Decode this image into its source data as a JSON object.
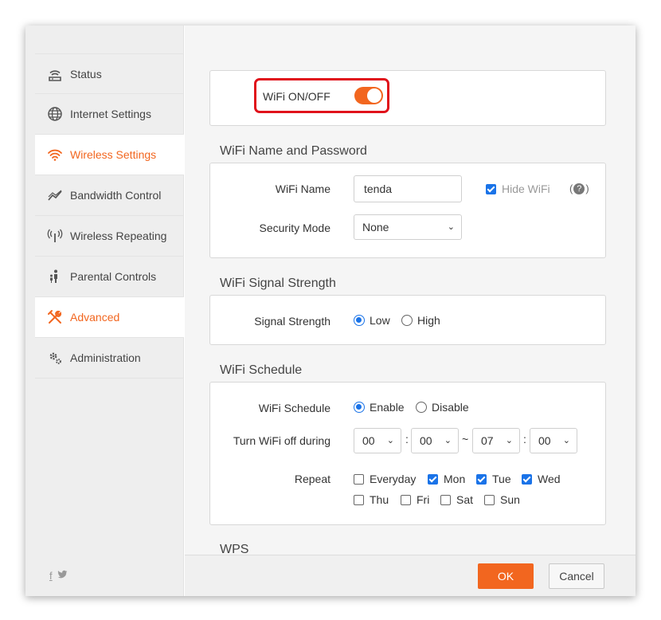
{
  "sidebar": {
    "items": [
      {
        "label": "Status",
        "icon": "router-icon",
        "active": false
      },
      {
        "label": "Internet Settings",
        "icon": "globe-icon",
        "active": false
      },
      {
        "label": "Wireless Settings",
        "icon": "wifi-icon",
        "active": true
      },
      {
        "label": "Bandwidth Control",
        "icon": "bandwidth-icon",
        "active": false
      },
      {
        "label": "Wireless Repeating",
        "icon": "antenna-icon",
        "active": false
      },
      {
        "label": "Parental Controls",
        "icon": "family-icon",
        "active": false
      },
      {
        "label": "Advanced",
        "icon": "tools-icon",
        "active": true
      },
      {
        "label": "Administration",
        "icon": "gears-icon",
        "active": false
      }
    ],
    "social": {
      "facebook": "f",
      "twitter": "t"
    }
  },
  "wifi_toggle": {
    "label": "WiFi ON/OFF",
    "on": true
  },
  "name_password": {
    "title": "WiFi Name and Password",
    "wifi_name_label": "WiFi Name",
    "wifi_name_value": "tenda",
    "hide_wifi_label": "Hide WiFi",
    "hide_wifi_checked": true,
    "help": "?",
    "security_mode_label": "Security Mode",
    "security_mode_value": "None"
  },
  "signal": {
    "title": "WiFi Signal Strength",
    "label": "Signal Strength",
    "options": [
      "Low",
      "High"
    ],
    "selected": "Low"
  },
  "schedule": {
    "title": "WiFi Schedule",
    "label": "WiFi Schedule",
    "options": [
      "Enable",
      "Disable"
    ],
    "selected": "Enable",
    "off_during_label": "Turn WiFi off during",
    "start_hour": "00",
    "start_min": "00",
    "end_hour": "07",
    "end_min": "00",
    "colon": ":",
    "tilde": "~",
    "repeat_label": "Repeat",
    "days": [
      {
        "label": "Everyday",
        "checked": false
      },
      {
        "label": "Mon",
        "checked": true
      },
      {
        "label": "Tue",
        "checked": true
      },
      {
        "label": "Wed",
        "checked": true
      },
      {
        "label": "Thu",
        "checked": false
      },
      {
        "label": "Fri",
        "checked": false
      },
      {
        "label": "Sat",
        "checked": false
      },
      {
        "label": "Sun",
        "checked": false
      }
    ]
  },
  "wps": {
    "title": "WPS"
  },
  "footer": {
    "ok": "OK",
    "cancel": "Cancel"
  },
  "colors": {
    "accent": "#f2661f",
    "highlight": "#e0121b",
    "checkbox": "#1a73e8"
  }
}
